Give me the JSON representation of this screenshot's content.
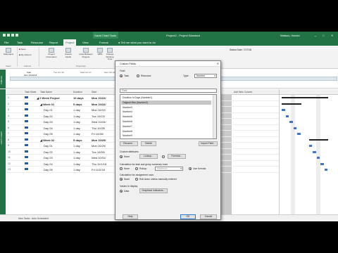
{
  "app": {
    "title_center": "Gantt Chart Tools",
    "title_doc": "Project2 - Project Standard",
    "user": "Watson, Harold",
    "ribbon_tabs": [
      "File",
      "Task",
      "Resource",
      "Report",
      "Project",
      "View",
      "Format"
    ],
    "tell_me": "Tell me what you want to do",
    "status_date": "Status Date: 7/17/18",
    "colors": {
      "brand": "#217346",
      "dialog_bg": "#f0f0f0",
      "gantt_bar": "#4472c4"
    }
  },
  "ribbon": {
    "buttons": [
      "Subproject",
      "Store",
      "My Add-ins",
      "Project Information",
      "Custom Fields",
      "Links Between Projects",
      "WBS",
      "Change Working Time"
    ],
    "groups": [
      "Insert",
      "Add-ins",
      "Properties"
    ]
  },
  "timeline": {
    "label": "TIMELINE",
    "dates": [
      "Tue Oct 16",
      "Wed Oct 17",
      "Mon Oct 22"
    ],
    "start_label": "Start",
    "start_date": "Mon 10/22/18"
  },
  "table": {
    "side_label": "GANTT CHART",
    "headers": [
      "",
      "Task Mode",
      "Task Name",
      "Duration",
      "Start",
      "Add New Column"
    ],
    "rows": [
      {
        "num": "1",
        "name": "2 Week Project",
        "duration": "10 days",
        "start": "Mon 10/22/",
        "bold": true,
        "indent": 0
      },
      {
        "num": "2",
        "name": "Week 01",
        "duration": "5 days",
        "start": "Mon 10/22/",
        "bold": true,
        "indent": 1
      },
      {
        "num": "3",
        "name": "Day 01",
        "duration": "1 day",
        "start": "Mon 10/22/",
        "bold": false,
        "indent": 2
      },
      {
        "num": "4",
        "name": "Day 02",
        "duration": "1 day",
        "start": "Tue 10/23/",
        "bold": false,
        "indent": 2
      },
      {
        "num": "5",
        "name": "Day 03",
        "duration": "1 day",
        "start": "Wed 10/24/",
        "bold": false,
        "indent": 2
      },
      {
        "num": "6",
        "name": "Day 04",
        "duration": "1 day",
        "start": "Thu 10/25/",
        "bold": false,
        "indent": 2
      },
      {
        "num": "7",
        "name": "Day 05",
        "duration": "1 day",
        "start": "Fri 10/26/",
        "bold": false,
        "indent": 2
      },
      {
        "num": "8",
        "name": "Week 02",
        "duration": "5 days",
        "start": "Mon 10/29/",
        "bold": true,
        "indent": 1
      },
      {
        "num": "9",
        "name": "Day 01",
        "duration": "1 day",
        "start": "Mon 10/29/",
        "bold": false,
        "indent": 2
      },
      {
        "num": "10",
        "name": "Day 02",
        "duration": "1 day",
        "start": "Tue 10/30/",
        "bold": false,
        "indent": 2
      },
      {
        "num": "11",
        "name": "Day 03",
        "duration": "1 day",
        "start": "Wed 10/31/",
        "bold": false,
        "indent": 2
      },
      {
        "num": "12",
        "name": "Day 04",
        "duration": "1 day",
        "start": "Thu 11/1/18",
        "bold": false,
        "indent": 2
      },
      {
        "num": "13",
        "name": "Day 05",
        "duration": "1 day",
        "start": "Fri 11/2/18",
        "bold": false,
        "indent": 2
      }
    ]
  },
  "status_bar": {
    "text": "New Tasks : Auto Scheduled"
  },
  "dialog": {
    "title": "Custom Fields",
    "close": "✕",
    "field_label": "Field",
    "radio_task": "Task",
    "radio_resource": "Resource",
    "type_label": "Type:",
    "type_value": "Number",
    "search_placeholder": "Field",
    "fields": [
      "Duration In Days (Number1)",
      "Original Max (Number2)",
      "Number3",
      "Number4",
      "Number5",
      "Number6",
      "Number7",
      "Number8",
      "Number9"
    ],
    "selected_field_index": 1,
    "btn_rename": "Rename...",
    "btn_delete": "Delete",
    "btn_import": "Import Field...",
    "custom_attributes_label": "Custom attributes",
    "radio_none": "None",
    "btn_lookup": "Lookup...",
    "radio_formula": "Formula...",
    "rollup_label": "Calculation for task and group summary rows",
    "rollup_none": "None",
    "rollup_rollup": "Rollup:",
    "rollup_select": "Maximum",
    "rollup_use_formula": "Use formula",
    "assign_label": "Calculation for assignment rows",
    "assign_none": "None",
    "assign_rollup": "Roll down unless manually entered",
    "display_label": "Values to display",
    "display_data": "Data",
    "btn_graphical": "Graphical Indicators...",
    "btn_help": "Help",
    "btn_ok": "OK",
    "btn_cancel": "Cancel"
  }
}
